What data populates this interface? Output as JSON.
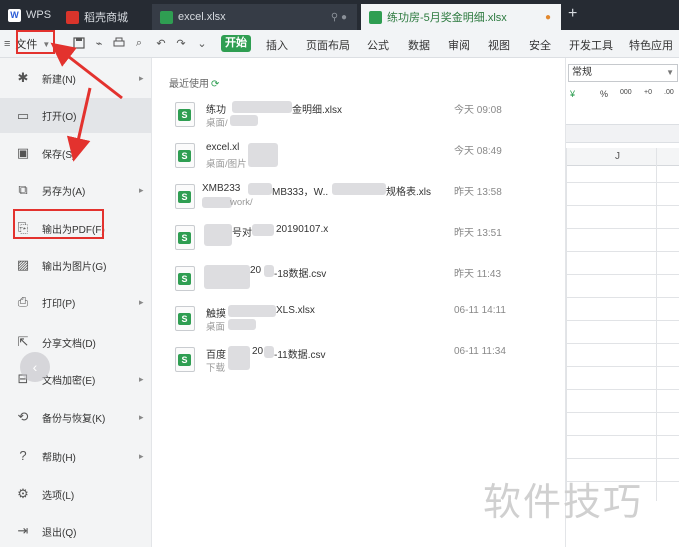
{
  "tabs": {
    "wps": "WPS",
    "store": "稻壳商城",
    "excel": "excel.xlsx",
    "excel_tail": "⚲ ●",
    "active": "练功房-5月奖金明细.xlsx",
    "active_tail": "●",
    "new_tab": "+"
  },
  "ribbon": {
    "file_label": "文件",
    "start_label": "开始",
    "menu_tabs": [
      "插入",
      "页面布局",
      "公式",
      "数据",
      "审阅",
      "视图",
      "安全",
      "开发工具",
      "特色应用"
    ]
  },
  "file_menu": {
    "items": [
      {
        "label": "新建(N)",
        "icon": "new-icon",
        "arrow": true
      },
      {
        "label": "打开(O)",
        "icon": "open-folder-icon",
        "arrow": false
      },
      {
        "label": "保存(S)",
        "icon": "save-icon",
        "arrow": false
      },
      {
        "label": "另存为(A)",
        "icon": "save-as-icon",
        "arrow": true
      },
      {
        "label": "输出为PDF(F)",
        "icon": "pdf-export-icon",
        "arrow": false
      },
      {
        "label": "输出为图片(G)",
        "icon": "image-export-icon",
        "arrow": false
      },
      {
        "label": "打印(P)",
        "icon": "print-icon",
        "arrow": true
      },
      {
        "label": "分享文档(D)",
        "icon": "share-icon",
        "arrow": false
      },
      {
        "label": "文档加密(E)",
        "icon": "encrypt-icon",
        "arrow": true
      },
      {
        "label": "备份与恢复(K)",
        "icon": "backup-icon",
        "arrow": true
      },
      {
        "label": "帮助(H)",
        "icon": "help-icon",
        "arrow": true
      },
      {
        "label": "选项(L)",
        "icon": "settings-icon",
        "arrow": false
      },
      {
        "label": "退出(Q)",
        "icon": "exit-icon",
        "arrow": false
      }
    ]
  },
  "recent": {
    "title": "最近使用",
    "files": [
      {
        "name": "练功",
        "name_end": "金明细.xlsx",
        "path": "桌面/",
        "time": "今天 09:08"
      },
      {
        "name": "excel.xl",
        "name_end": "",
        "path": "桌面/图片",
        "time": "今天 08:49"
      },
      {
        "name": "XMB233",
        "name_end": "MB333，W..",
        "name_end2": "规格表.xls",
        "path": "work/",
        "time": "昨天 13:58"
      },
      {
        "name": "",
        "name_end": "号对",
        "name_end2": "20190107.x",
        "path": "",
        "time": "昨天 13:51"
      },
      {
        "name": "",
        "name_end": "20",
        "name_end2": "-18数据.csv",
        "path": "",
        "time": "昨天 11:43"
      },
      {
        "name": "触摸",
        "name_end": "XLS.xlsx",
        "path": "桌面",
        "time": "06-11 14:11"
      },
      {
        "name": "百度",
        "name_end": "20",
        "name_end2": "-11数据.csv",
        "path": "下载",
        "time": "06-11 11:34"
      }
    ]
  },
  "sheet": {
    "number_format": "常规",
    "column": "J",
    "num_tools": [
      "¥",
      "%",
      "000",
      "+0",
      ".00",
      ".00"
    ]
  },
  "watermark": "软件技巧",
  "colors": {
    "accent_green": "#2f9e52",
    "annotation_red": "#e3322e",
    "titlebar": "#262b33"
  }
}
